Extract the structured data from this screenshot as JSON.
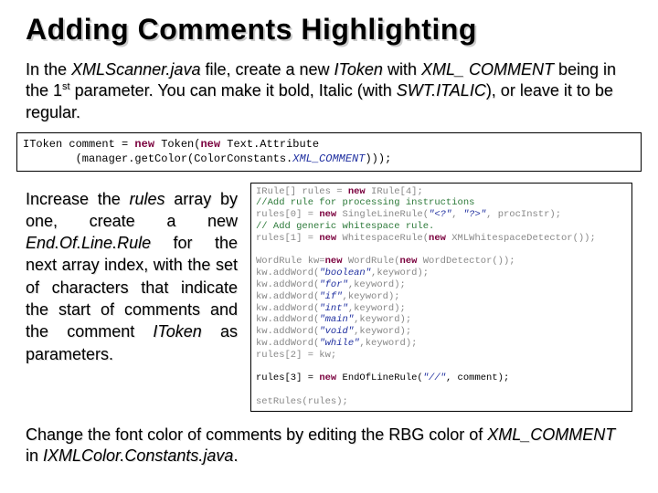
{
  "title": "Adding Comments Highlighting",
  "para1_parts": {
    "p1": "In the ",
    "p2": "XMLScanner.java",
    "p3": " file, create a new ",
    "p4": "IToken",
    "p5": " with ",
    "p6": "XML_ COMMENT",
    "p7": " being in the 1",
    "p8": "st",
    "p9": " parameter. You can make it bold, Italic (with ",
    "p10": "SWT.ITALIC",
    "p11": "), or leave it to be regular."
  },
  "code1_line1_a": "IToken comment = ",
  "code1_line1_b": "new",
  "code1_line1_c": " Token(",
  "code1_line1_d": "new",
  "code1_line1_e": " Text.Attribute",
  "code1_line2_a": "        (manager.getColor(ColorConstants.",
  "code1_line2_b": "XML_COMMENT",
  "code1_line2_c": ")));",
  "para2_parts": {
    "p1": "Increase the ",
    "p2": "rules",
    "p3": " array by one, create a new ",
    "p4": "End.Of.Line.Rule",
    "p5": " for the next array index, with the set of characters that indicate the start of comments and the comment ",
    "p6": "IToken",
    "p7": " as parameters."
  },
  "code2": {
    "l1a": "IRule[] rules = ",
    "l1b": "new",
    "l1c": " IRule[",
    "l1d": "4",
    "l1e": "];",
    "l2": "//Add rule for processing instructions",
    "l3a": "rules[0] = ",
    "l3b": "new",
    "l3c": " SingleLineRule(",
    "l3d": "\"<?\"",
    "l3e": ", ",
    "l3f": "\"?>\"",
    "l3g": ", procInstr);",
    "l4": "// Add generic whitespace rule.",
    "l5a": "rules[1] = ",
    "l5b": "new",
    "l5c": " WhitespaceRule(",
    "l5d": "new",
    "l5e": " XMLWhitespaceDetector());",
    "l6": "",
    "l7a": "WordRule kw=",
    "l7b": "new",
    "l7c": " WordRule(",
    "l7d": "new",
    "l7e": " WordDetector());",
    "l8a": "kw.addWord(",
    "l8b": "\"boolean\"",
    "l8c": ",keyword);",
    "l9a": "kw.addWord(",
    "l9b": "\"for\"",
    "l9c": ",keyword);",
    "l10a": "kw.addWord(",
    "l10b": "\"if\"",
    "l10c": ",keyword);",
    "l11a": "kw.addWord(",
    "l11b": "\"int\"",
    "l11c": ",keyword);",
    "l12a": "kw.addWord(",
    "l12b": "\"main\"",
    "l12c": ",keyword);",
    "l13a": "kw.addWord(",
    "l13b": "\"void\"",
    "l13c": ",keyword);",
    "l14a": "kw.addWord(",
    "l14b": "\"while\"",
    "l14c": ",keyword);",
    "l15": "rules[2] = kw;",
    "l16": "",
    "l17a": "rules[3] = ",
    "l17b": "new",
    "l17c": " EndOfLineRule(",
    "l17d": "\"//\"",
    "l17e": ", comment);",
    "l18": "",
    "l19": "setRules(rules);"
  },
  "para3_parts": {
    "p1": "Change the font color of comments by editing the RBG color of ",
    "p2": "XML_COMMENT",
    "p3": " in ",
    "p4": "IXMLColor.Constants.java",
    "p5": "."
  }
}
